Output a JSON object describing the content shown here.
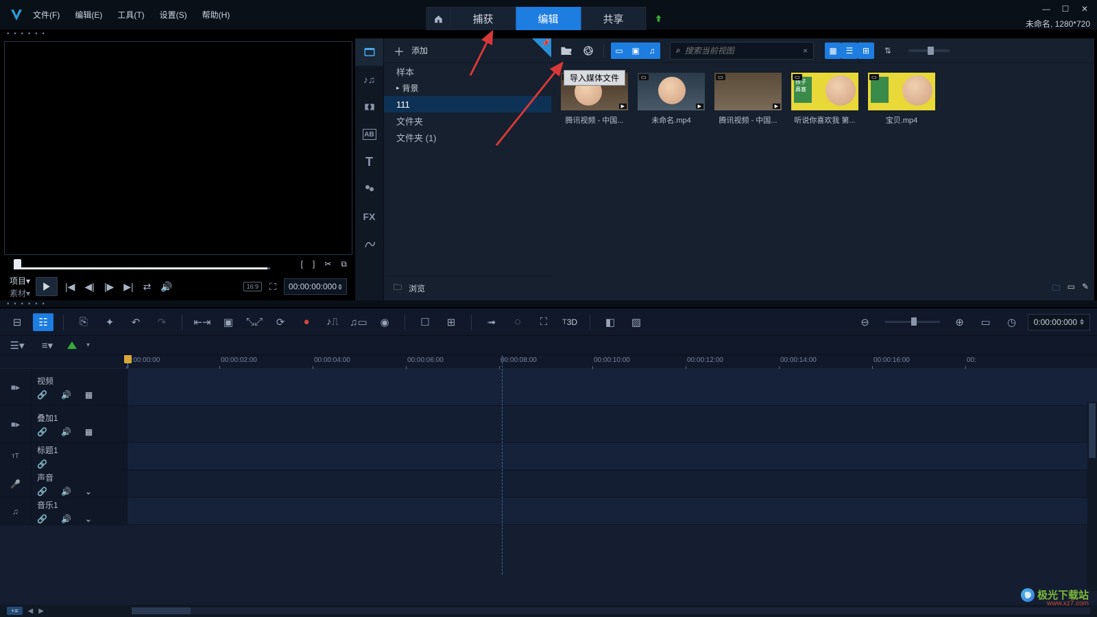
{
  "menu": {
    "file": "文件(F)",
    "edit": "编辑(E)",
    "tools": "工具(T)",
    "settings": "设置(S)",
    "help": "帮助(H)"
  },
  "tabs": {
    "capture": "捕获",
    "edit": "编辑",
    "share": "共享"
  },
  "project": {
    "name": "未命名",
    "res": "1280*720"
  },
  "preview": {
    "project": "项目▾",
    "material": "素材▾",
    "ratio": "16:9",
    "timecode": "00:00:00:000"
  },
  "library": {
    "add": "添加",
    "tree": [
      "样本",
      "背景",
      "111",
      "文件夹",
      "文件夹 (1)"
    ],
    "browse": "浏览",
    "search_ph": "搜索当前视图",
    "tooltip": "导入媒体文件",
    "items": [
      {
        "label": "腾讯视频 - 中国..."
      },
      {
        "label": "未命名.mp4"
      },
      {
        "label": "腾讯视频 - 中国..."
      },
      {
        "label": "听说你喜欢我 第..."
      },
      {
        "label": "宝贝.mp4"
      }
    ]
  },
  "timeline": {
    "timecode": "0:00:00:000",
    "ruler": [
      "0:00:00:00",
      "00:00:02:00",
      "00:00:04:00",
      "00:00:06:00",
      "00:00:08:00",
      "00:00:10:00",
      "00:00:12:00",
      "00:00:14:00",
      "00:00:16:00",
      "00:"
    ],
    "tracks": [
      {
        "name": "视频",
        "ctrls": [
          "link",
          "vol",
          "grid"
        ],
        "h": "tall"
      },
      {
        "name": "叠加1",
        "ctrls": [
          "link",
          "vol",
          "grid"
        ],
        "h": "tall"
      },
      {
        "name": "标题1",
        "ctrls": [
          "link"
        ],
        "h": "short"
      },
      {
        "name": "声音",
        "ctrls": [
          "link",
          "vol",
          "chev"
        ],
        "h": "short"
      },
      {
        "name": "音乐1",
        "ctrls": [
          "link",
          "vol",
          "chev"
        ],
        "h": "short"
      }
    ],
    "track_icons": [
      "video",
      "video",
      "text",
      "mic",
      "music"
    ]
  },
  "watermark": {
    "text": "极光下载站",
    "url": "www.xz7.com"
  }
}
